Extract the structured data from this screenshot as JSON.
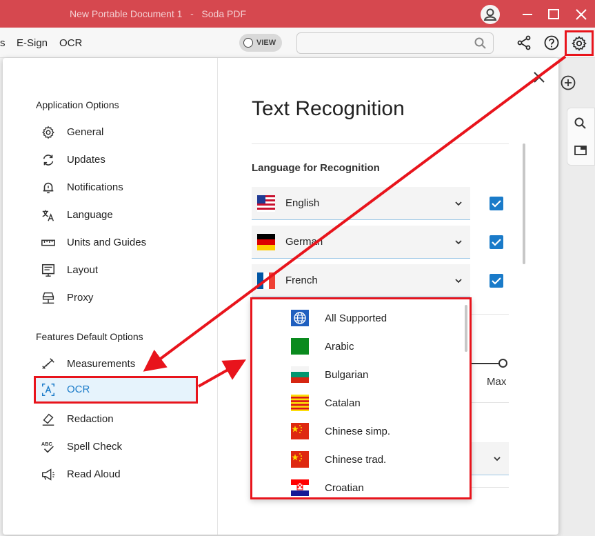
{
  "window": {
    "title": "New Portable Document 1   -   Soda PDF"
  },
  "toolbar": {
    "menu_partial": "s",
    "esign_label": "E-Sign",
    "ocr_label": "OCR",
    "view_label": "VIEW"
  },
  "dialog": {
    "app_options_title": "Application Options",
    "features_title": "Features Default Options",
    "app_items": [
      {
        "label": "General",
        "icon": "gear-icon"
      },
      {
        "label": "Updates",
        "icon": "refresh-icon"
      },
      {
        "label": "Notifications",
        "icon": "bell-icon"
      },
      {
        "label": "Language",
        "icon": "translate-icon"
      },
      {
        "label": "Units and Guides",
        "icon": "ruler-icon"
      },
      {
        "label": "Layout",
        "icon": "layout-icon"
      },
      {
        "label": "Proxy",
        "icon": "proxy-icon"
      }
    ],
    "feature_items": [
      {
        "label": "Measurements",
        "icon": "measure-icon"
      },
      {
        "label": "OCR",
        "icon": "ocr-icon",
        "active": true
      },
      {
        "label": "Redaction",
        "icon": "eraser-icon"
      },
      {
        "label": "Spell Check",
        "icon": "spellcheck-icon"
      },
      {
        "label": "Read Aloud",
        "icon": "megaphone-icon"
      }
    ],
    "heading": "Text Recognition",
    "language_subhead": "Language for Recognition",
    "selected_languages": [
      {
        "label": "English",
        "flag": "us-flag-icon",
        "checked": true
      },
      {
        "label": "German",
        "flag": "germany-flag-icon",
        "checked": true
      },
      {
        "label": "French",
        "flag": "france-flag-icon",
        "checked": true
      }
    ],
    "max_label": "Max",
    "dropdown_options": [
      {
        "label": "All Supported",
        "flag": "globe-icon"
      },
      {
        "label": "Arabic",
        "flag": "arabic-flag-icon"
      },
      {
        "label": "Bulgarian",
        "flag": "bulgaria-flag-icon"
      },
      {
        "label": "Catalan",
        "flag": "catalonia-flag-icon"
      },
      {
        "label": "Chinese simp.",
        "flag": "china-flag-icon"
      },
      {
        "label": "Chinese trad.",
        "flag": "china-flag-icon"
      },
      {
        "label": "Croatian",
        "flag": "croatia-flag-icon"
      }
    ]
  },
  "colors": {
    "titlebar": "#d6484f",
    "accent_blue": "#1a7bc9",
    "annotation_red": "#e8141c"
  }
}
